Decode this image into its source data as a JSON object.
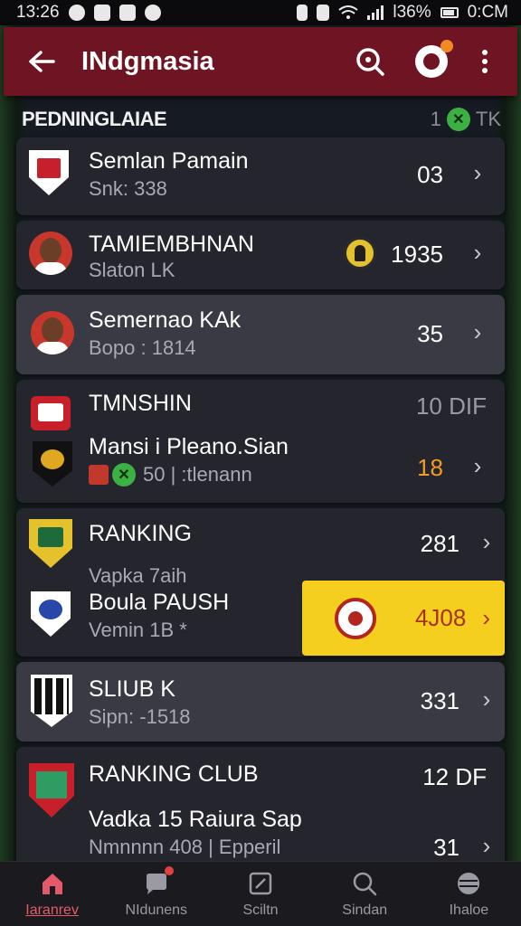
{
  "status_bar": {
    "time": "13:26",
    "battery": "Ɩ36%",
    "clock_right": "0:CM"
  },
  "app_bar": {
    "title": "INdgmasia",
    "back_icon": "arrow-left-icon",
    "search_icon": "search-icon",
    "profile_icon": "profile-badge-icon",
    "more_icon": "more-vertical-icon",
    "color": "#6e1422"
  },
  "section": {
    "label": "PEDNINGLAIAE",
    "count": "1",
    "suffix": "TK"
  },
  "rows": [
    {
      "title": "Semlan Pamain",
      "subtitle": "Snk: 338",
      "value": "03"
    },
    {
      "title": "TAMIEMBHNAN",
      "subtitle": "Slaton LK",
      "value": "1935"
    },
    {
      "title": "Semernao KAk",
      "subtitle": "Bopo : 1814",
      "value": "35"
    },
    {
      "title": "TMNSHIN",
      "value_top": "10 DIF",
      "title2": "Mansi i Pleano.Sian",
      "subtitle": "50 | :tlenann",
      "value": "18"
    },
    {
      "title": "RANKING",
      "value_top": "281",
      "subtitle_a": "Vapka 7aih",
      "title2": "Boula PAUSH",
      "subtitle": "Vemin 1B *",
      "value": "4J08"
    },
    {
      "title": "SLIUB K",
      "subtitle": "Sipn: -1518",
      "value": "331"
    },
    {
      "title": "RANKING CLUB",
      "value_top": "12 DF",
      "title2": "Vadka 15 Raiura Sap",
      "subtitle": "Nmnnnn 408 | Epperil",
      "value": "31"
    }
  ],
  "accent_colors": {
    "highlight": "#f5cf1d",
    "orange_value": "#f39a25",
    "green_badge": "#3cb043",
    "card": "#25252d"
  },
  "bottom_nav": [
    {
      "label": "Iaranrev",
      "icon": "home-icon",
      "active": true
    },
    {
      "label": "NIdunens",
      "icon": "chat-icon",
      "active": false
    },
    {
      "label": "Sciltn",
      "icon": "edit-square-icon",
      "active": false
    },
    {
      "label": "Sindan",
      "icon": "search-icon",
      "active": false
    },
    {
      "label": "Ihaloe",
      "icon": "ball-icon",
      "active": false
    }
  ]
}
